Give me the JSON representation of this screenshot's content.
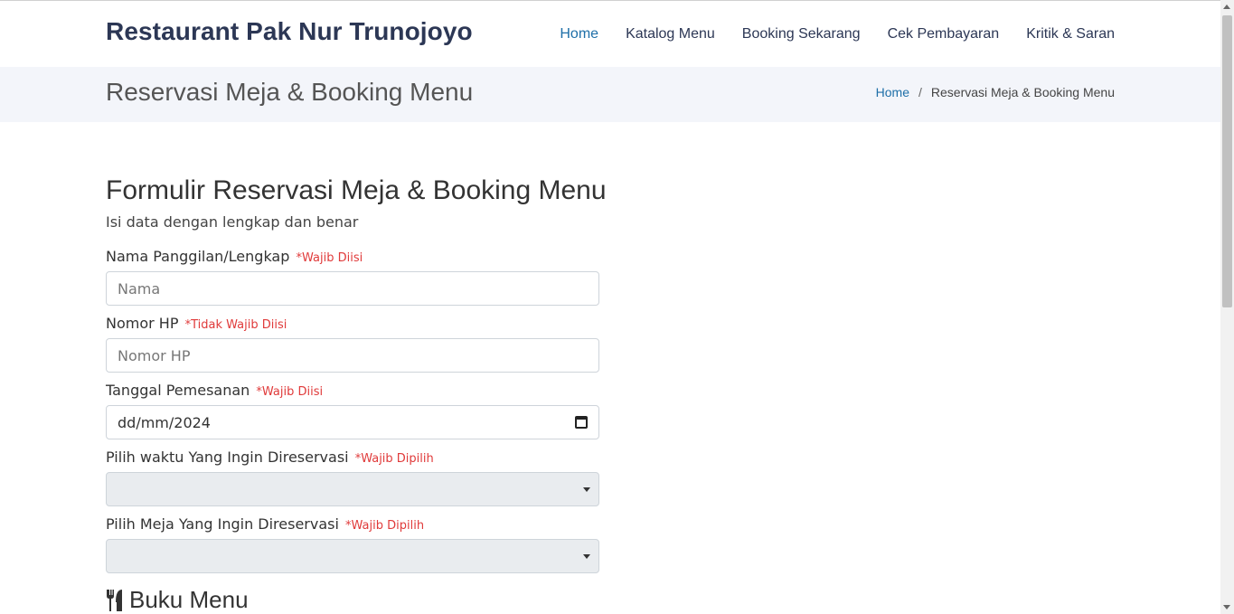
{
  "header": {
    "brand": "Restaurant Pak Nur Trunojoyo",
    "nav": [
      {
        "label": "Home",
        "active": true
      },
      {
        "label": "Katalog Menu",
        "active": false
      },
      {
        "label": "Booking Sekarang",
        "active": false
      },
      {
        "label": "Cek Pembayaran",
        "active": false
      },
      {
        "label": "Kritik & Saran",
        "active": false
      }
    ]
  },
  "breadcrumbs": {
    "page_title": "Reservasi Meja & Booking Menu",
    "home": "Home",
    "separator": "/",
    "current": "Reservasi Meja & Booking Menu"
  },
  "form": {
    "title": "Formulir Reservasi Meja & Booking Menu",
    "subtitle": "Isi data dengan lengkap dan benar",
    "fields": {
      "name": {
        "label": "Nama Panggilan/Lengkap",
        "note": "*Wajib Diisi",
        "placeholder": "Nama"
      },
      "phone": {
        "label": "Nomor HP",
        "note": "*Tidak Wajib Diisi",
        "placeholder": "Nomor HP"
      },
      "date": {
        "label": "Tanggal Pemesanan",
        "note": "*Wajib Diisi",
        "value": "dd/mm/2024"
      },
      "time": {
        "label": "Pilih waktu Yang Ingin Direservasi",
        "note": "*Wajib Dipilih",
        "value": ""
      },
      "table": {
        "label": "Pilih Meja Yang Ingin Direservasi",
        "note": "*Wajib Dipilih",
        "value": ""
      }
    }
  },
  "menu_section": {
    "title": "Buku Menu",
    "icon": "utensils-icon"
  },
  "colors": {
    "brand": "#2c3755",
    "link": "#1e6fa8",
    "required": "#e03a3a",
    "band": "#f3f5fa"
  }
}
